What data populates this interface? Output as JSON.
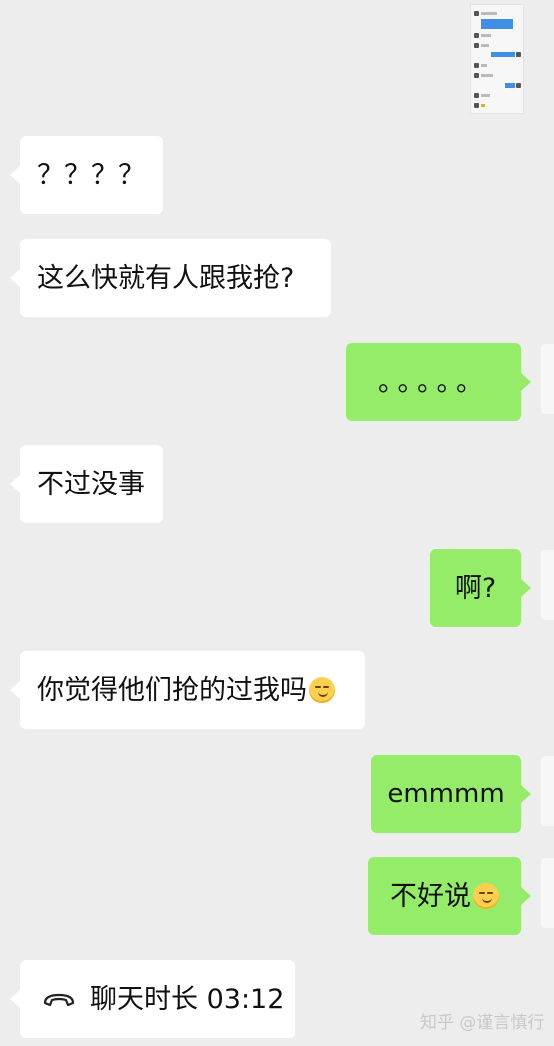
{
  "messages": [
    {
      "side": "left",
      "text": "？？？？"
    },
    {
      "side": "left",
      "text": "这么快就有人跟我抢?"
    },
    {
      "side": "right",
      "text": "。。。。。"
    },
    {
      "side": "left",
      "text": "不过没事"
    },
    {
      "side": "right",
      "text": "啊?"
    },
    {
      "side": "left",
      "text": "你觉得他们抢的过我吗",
      "emoji": "smirk-emoji"
    },
    {
      "side": "right",
      "text": "emmmm"
    },
    {
      "side": "right",
      "text": "不好说",
      "emoji": "smirk-emoji"
    },
    {
      "side": "left",
      "text": "聊天时长 03:12",
      "icon": "phone-hangup-icon"
    }
  ],
  "watermark": "知乎 @谨言慎行",
  "colors": {
    "background": "#ededed",
    "left_bubble": "#ffffff",
    "right_bubble": "#95ec69"
  }
}
